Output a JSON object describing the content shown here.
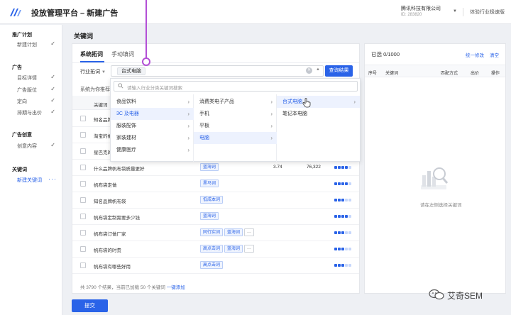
{
  "header": {
    "app_title": "投放管理平台 – 新建广告",
    "company": "腾讯科技有限公司",
    "company_id": "ID: 283820",
    "link": "体验行业极速版"
  },
  "sidebar": {
    "groups": [
      {
        "title": "推广计划",
        "items": [
          {
            "label": "新建计划",
            "done": "✓"
          }
        ]
      },
      {
        "title": "广告",
        "items": [
          {
            "label": "目标详情",
            "done": "✓"
          },
          {
            "label": "广告版位",
            "done": "✓"
          },
          {
            "label": "定向",
            "done": "✓"
          },
          {
            "label": "排期与出价",
            "done": "✓"
          }
        ]
      },
      {
        "title": "广告创意",
        "items": [
          {
            "label": "创意内容",
            "done": "✓"
          }
        ]
      },
      {
        "title": "关键词",
        "items": [
          {
            "label": "新建关键词",
            "done": "···"
          }
        ]
      }
    ]
  },
  "main": {
    "title": "关键词",
    "tabs": [
      "系统拓词",
      "手动填词"
    ],
    "filter_select": "行业拓词",
    "search_tag": "台式电脑",
    "search_button": "查询结果",
    "recommend_text": "系统为你推荐",
    "table_headers": {
      "keyword": "关键词"
    },
    "rows": [
      {
        "keyword": "知名品牌",
        "tags": [],
        "n1": "",
        "n2": "",
        "bar": 4
      },
      {
        "keyword": "淘宝的帆",
        "tags": [],
        "n1": "",
        "n2": "",
        "bar": 3
      },
      {
        "keyword": "星巴克的",
        "tags": [],
        "n1": "",
        "n2": "",
        "bar": 4
      },
      {
        "keyword": "什么品牌帆布袋质量更好",
        "tags": [
          "蓝海词"
        ],
        "n1": "3.74",
        "n2": "76,322",
        "bar": 4
      },
      {
        "keyword": "帆布袋定做",
        "tags": [
          "黑马词"
        ],
        "n1": "",
        "n2": "",
        "bar": 4
      },
      {
        "keyword": "知名品牌帆布袋",
        "tags": [
          "低成本词"
        ],
        "n1": "",
        "n2": "",
        "bar": 3
      },
      {
        "keyword": "帆布袋定制需要多少钱",
        "tags": [
          "蓝海词"
        ],
        "n1": "",
        "n2": "",
        "bar": 4
      },
      {
        "keyword": "帆布袋订做厂家",
        "tags": [
          "同行实词",
          "蓝海词",
          "···"
        ],
        "n1": "",
        "n2": "",
        "bar": 3
      },
      {
        "keyword": "帆布袋的时贵",
        "tags": [
          "高点击词",
          "蓝海词",
          "···"
        ],
        "n1": "",
        "n2": "",
        "bar": 3
      },
      {
        "keyword": "帆布袋有哪些好用",
        "tags": [
          "高点击词"
        ],
        "n1": "",
        "n2": "",
        "bar": 3
      }
    ],
    "footer": {
      "text": "共 3790 个结果，当前已加载 50 个关键词",
      "link": "一键添加"
    },
    "submit": "提交"
  },
  "dropdown": {
    "placeholder": "请输入行业分类关键词搜索",
    "col1": [
      "食品饮料",
      "3C 及电器",
      "服装配饰",
      "家装建材",
      "健康医疗"
    ],
    "col2": [
      "消费类电子产品",
      "手机",
      "平板",
      "电脑"
    ],
    "col3": [
      "台式电脑",
      "笔记本电脑"
    ]
  },
  "right_panel": {
    "selected_count": "已选 0/1000",
    "batch_edit": "统一修改",
    "clear": "清空",
    "headers": [
      "序号",
      "关键词",
      "匹配方式",
      "出价",
      "操作"
    ],
    "empty_text": "请在左侧选择关键词"
  },
  "watermark": "艾奇SEM",
  "colors": {
    "accent": "#2a63e8",
    "pointer": "#b34fd6"
  }
}
